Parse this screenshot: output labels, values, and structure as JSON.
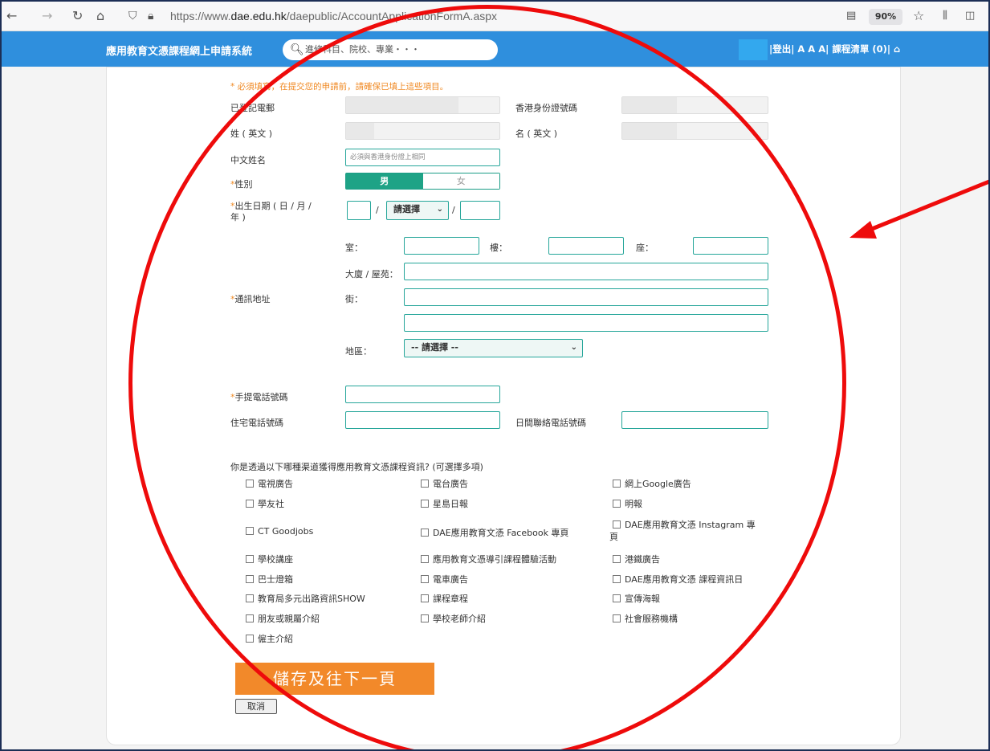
{
  "browser": {
    "url_prefix": "https://www.",
    "url_domain": "dae.edu.hk",
    "url_path": "/daepublic/AccountApplicationFormA.aspx",
    "zoom": "90%"
  },
  "site": {
    "title": "應用教育文憑課程網上申請系統",
    "search_placeholder": "進修科目、院校、專業・・・",
    "header_links": "|登出| A A A| 課程清單 (0)| "
  },
  "form": {
    "notice": "* 必須填寫，在提交您的申請前，請確保已填上這些項目。",
    "email_label": "已登記電郵",
    "hkid_label": "香港身份證號碼",
    "surname_label": "姓 ( 英文 )",
    "given_name_label": "名 ( 英文 )",
    "chinese_name_label": "中文姓名",
    "chinese_name_placeholder": "必須與香港身份證上相同",
    "gender_label": "性別",
    "gender_male": "男",
    "gender_female": "女",
    "dob_label_1": "出生日期 ( 日 / 月 /",
    "dob_label_2": "年 )",
    "dob_sep": "/",
    "dob_month": "請選擇",
    "address_label": "通訊地址",
    "room_label": "室：",
    "floor_label": "樓：",
    "block_label": "座：",
    "building_label": "大廈 / 屋苑：",
    "street_label": "街：",
    "district_label": "地區：",
    "district_value": "-- 請選擇 --",
    "mobile_label": "手提電話號碼",
    "home_phone_label": "住宅電話號碼",
    "day_phone_label": "日間聯絡電話號碼",
    "channel_question": "你是透過以下哪種渠道獲得應用教育文憑課程資訊? (可選擇多項)",
    "channels": [
      "電視廣告",
      "電台廣告",
      "網上Google廣告",
      "學友社",
      "星島日報",
      "明報",
      "CT Goodjobs",
      "DAE應用教育文憑 Facebook 專頁",
      "DAE應用教育文憑 Instagram 專",
      "學校講座",
      "應用教育文憑導引課程體驗活動",
      "港鐵廣告",
      "巴士燈箱",
      "電車廣告",
      "DAE應用教育文憑 課程資訊日",
      "教育局多元出路資訊SHOW",
      "課程章程",
      "宣傳海報",
      "朋友或親屬介紹",
      "學校老師介紹",
      "社會服務機構",
      "僱主介紹"
    ],
    "channel_wrap": "頁",
    "save_button": "儲存及往下一頁",
    "cancel_button": "取消"
  },
  "colors": {
    "header_blue": "#2f8fdd",
    "accent_teal": "#1ea386",
    "required_orange": "#f08a24",
    "annotation_red": "#ee0b0b"
  }
}
